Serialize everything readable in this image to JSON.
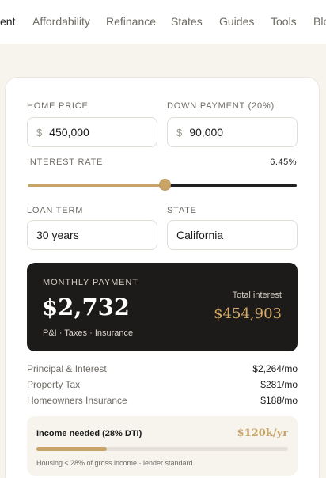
{
  "nav": {
    "items": [
      {
        "label": "ent",
        "active": true
      },
      {
        "label": "Affordability",
        "active": false
      },
      {
        "label": "Refinance",
        "active": false
      },
      {
        "label": "States",
        "active": false
      },
      {
        "label": "Guides",
        "active": false
      },
      {
        "label": "Tools",
        "active": false
      },
      {
        "label": "Blo",
        "active": false
      }
    ]
  },
  "form": {
    "home_price": {
      "label": "HOME PRICE",
      "currency": "$",
      "value": "450,000"
    },
    "down_payment": {
      "label": "DOWN PAYMENT (20%)",
      "currency": "$",
      "value": "90,000"
    },
    "interest_rate": {
      "label": "INTEREST RATE",
      "value": "6.45%",
      "slider_fraction": 0.51
    },
    "loan_term": {
      "label": "LOAN TERM",
      "value": "30 years"
    },
    "state": {
      "label": "STATE",
      "value": "California"
    }
  },
  "payment": {
    "title": "MONTHLY PAYMENT",
    "amount": "$2,732",
    "breakdown_note": "P&I · Taxes · Insurance",
    "total_interest_label": "Total interest",
    "total_interest_value": "$454,903"
  },
  "lines": [
    {
      "label": "Principal & Interest",
      "value": "$2,264/mo"
    },
    {
      "label": "Property Tax",
      "value": "$281/mo"
    },
    {
      "label": "Homeowners Insurance",
      "value": "$188/mo"
    }
  ],
  "income": {
    "label": "Income needed (28% DTI)",
    "value": "$120k/yr",
    "bar_fraction": 0.28,
    "note": "Housing ≤ 28% of gross income · lender standard"
  },
  "colors": {
    "accent": "#c8a468",
    "dark_panel": "#1d1b1a",
    "background": "#f7f4ee"
  }
}
